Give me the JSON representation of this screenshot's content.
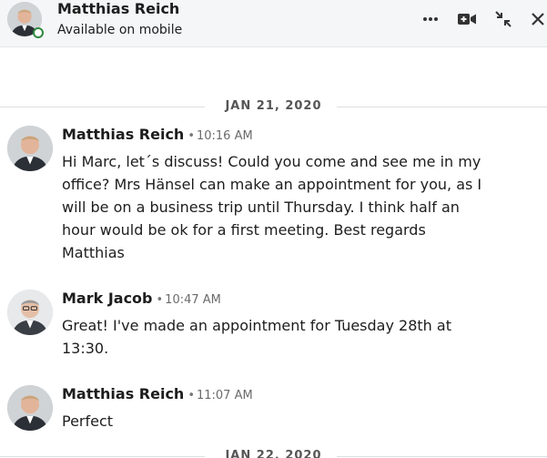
{
  "header": {
    "contact_name": "Matthias Reich",
    "status": "Available on mobile",
    "presence_color": "#2e8a3e",
    "actions": [
      "more-options-icon",
      "video-call-icon",
      "minimize-icon",
      "close-icon"
    ]
  },
  "dates": [
    {
      "label": "JAN 21, 2020"
    },
    {
      "label": "JAN 22, 2020"
    }
  ],
  "messages": [
    {
      "sender": "Matthias Reich",
      "separator": "•",
      "time": "10:16 AM",
      "text": "Hi Marc, let´s discuss! Could you come and see me in my office? Mrs Hänsel can make an appointment for you, as I will be on a business trip until Thursday. I think half an hour would be ok for a first meeting. Best regards Matthias"
    },
    {
      "sender": "Mark Jacob",
      "separator": "•",
      "time": "10:47 AM",
      "text": "Great! I've made an appointment for Tuesday 28th at 13:30."
    },
    {
      "sender": "Matthias Reich",
      "separator": "•",
      "time": "11:07 AM",
      "text": "Perfect"
    }
  ]
}
